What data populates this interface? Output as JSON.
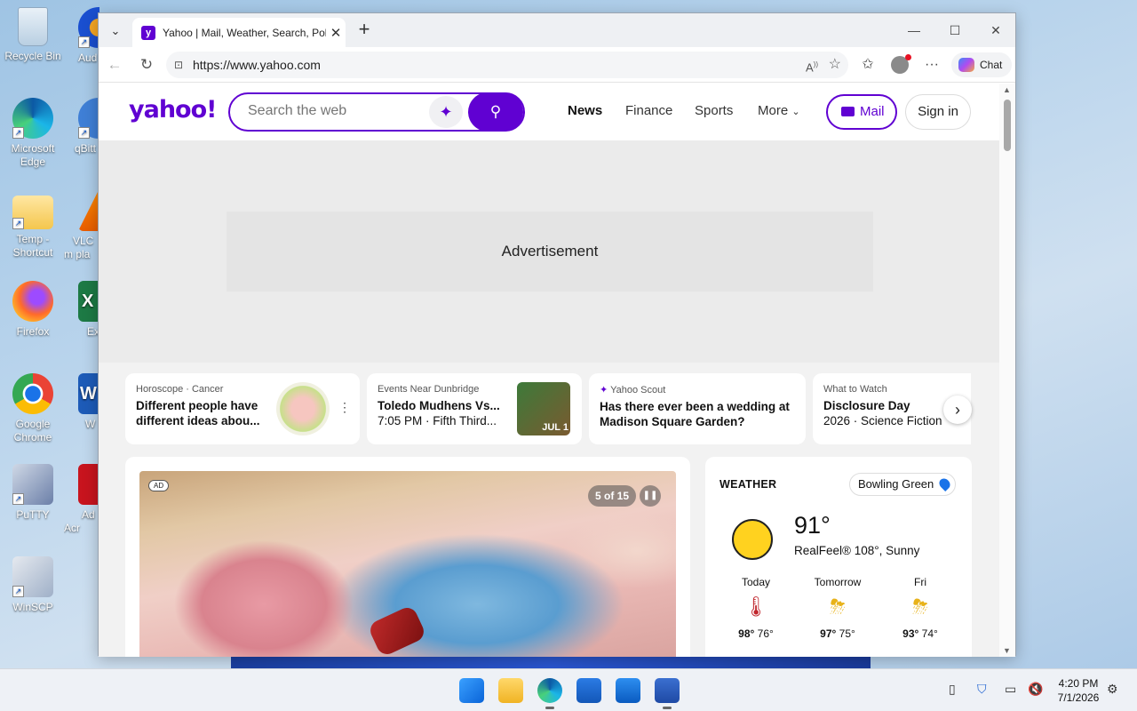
{
  "desktop": {
    "icons": [
      {
        "label": "Recycle Bin"
      },
      {
        "label": "Aud"
      },
      {
        "label": "Microsoft Edge"
      },
      {
        "label": "qBitt"
      },
      {
        "label": "Temp - Shortcut"
      },
      {
        "label": "VLC m pla"
      },
      {
        "label": "Firefox"
      },
      {
        "label": "Ex"
      },
      {
        "label": "Google Chrome"
      },
      {
        "label": "W"
      },
      {
        "label": "PuTTY"
      },
      {
        "label": "Ad Acr"
      },
      {
        "label": "WinSCP"
      }
    ]
  },
  "browser": {
    "tab_title": "Yahoo | Mail, Weather, Search, Poli",
    "url": "https://www.yahoo.com",
    "copilot_label": "Chat"
  },
  "yahoo": {
    "logo": "yahoo!",
    "search_placeholder": "Search the web",
    "nav": [
      "News",
      "Finance",
      "Sports",
      "More"
    ],
    "mail_label": "Mail",
    "signin_label": "Sign in",
    "ad_label": "Advertisement",
    "cards": [
      {
        "kicker": "Horoscope · Cancer",
        "head": "Different people have",
        "sub": "different ideas abou..."
      },
      {
        "kicker": "Events Near Dunbridge",
        "head": "Toledo Mudhens Vs....",
        "sub": "7:05 PM · Fifth Third...",
        "thumb_label": "JUL 1"
      },
      {
        "kicker": "Yahoo Scout",
        "head": "Has there ever been a wedding at",
        "sub": "Madison Square Garden?"
      },
      {
        "kicker": "What to Watch",
        "head": "Disclosure Day",
        "sub": "2026 · Science Fiction"
      }
    ],
    "hero": {
      "ad_badge": "AD",
      "counter": "5 of 15"
    },
    "weather": {
      "title": "WEATHER",
      "location": "Bowling Green",
      "temp": "91°",
      "realfeel": "RealFeel® 108°, Sunny",
      "forecast": [
        {
          "day": "Today",
          "hi": "98°",
          "lo": "76°"
        },
        {
          "day": "Tomorrow",
          "hi": "97°",
          "lo": "75°"
        },
        {
          "day": "Fri",
          "hi": "93°",
          "lo": "74°"
        }
      ]
    }
  },
  "taskbar": {
    "time": "4:20 PM",
    "date": "7/1/2026"
  }
}
